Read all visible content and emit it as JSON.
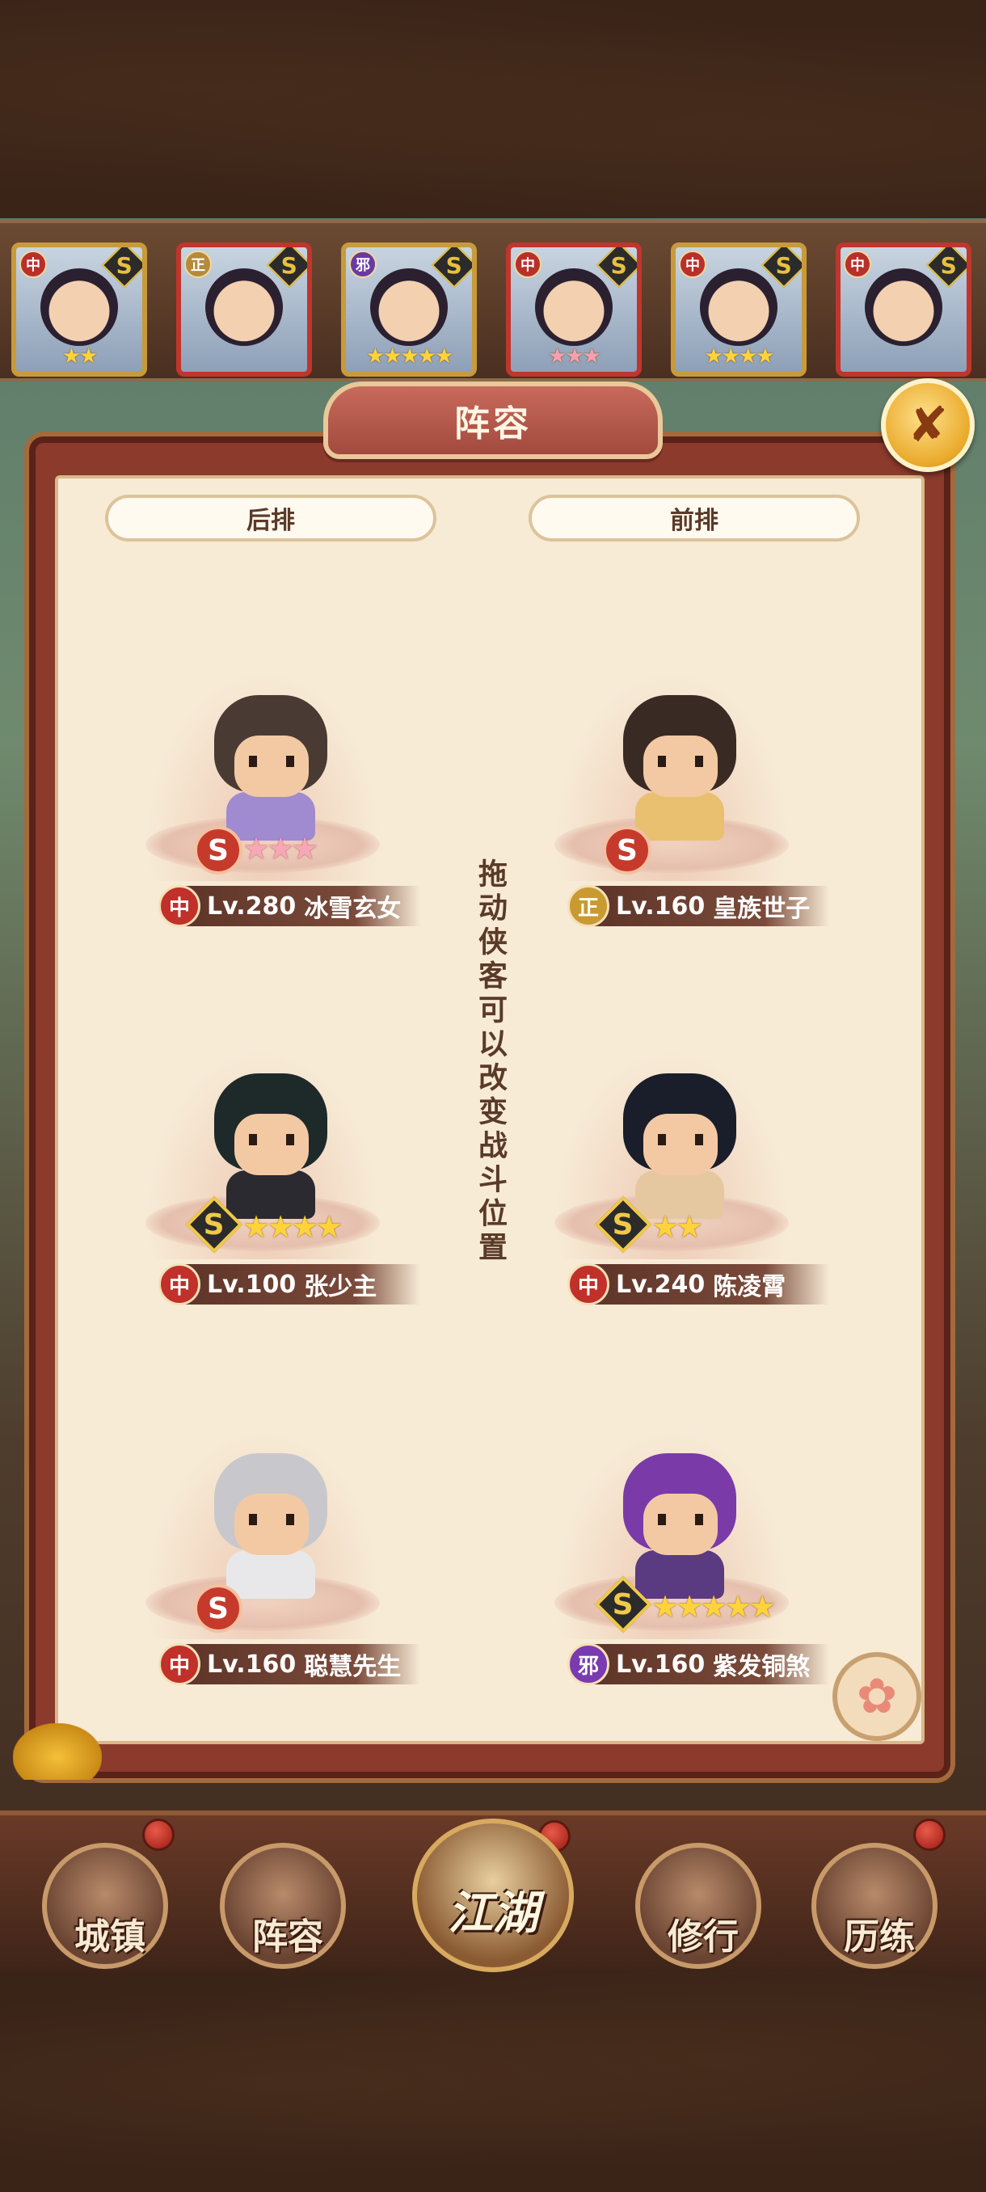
{
  "hero_strip": [
    {
      "faction": "中",
      "grade": "S",
      "stars": "★★",
      "star_color": "gold",
      "frame": "gold"
    },
    {
      "faction": "正",
      "grade": "S",
      "stars": "",
      "star_color": "gold",
      "frame": "red"
    },
    {
      "faction": "邪",
      "grade": "S",
      "stars": "★★★★★",
      "star_color": "gold",
      "frame": "gold"
    },
    {
      "faction": "中",
      "grade": "S",
      "stars": "★★★",
      "star_color": "pink",
      "frame": "red"
    },
    {
      "faction": "中",
      "grade": "S",
      "stars": "★★★★",
      "star_color": "gold",
      "frame": "gold"
    },
    {
      "faction": "中",
      "grade": "S",
      "stars": "",
      "star_color": "gold",
      "frame": "red"
    }
  ],
  "dialog": {
    "title": "阵容",
    "close_icon": "close-icon",
    "back_row_label": "后排",
    "front_row_label": "前排",
    "hint": "拖动侠客可以改变战斗位置"
  },
  "lineup": {
    "back": [
      {
        "faction": "中",
        "level": "Lv.280",
        "name": "冰雪玄女",
        "grade_style": "red",
        "stars": "★★★",
        "star_color": "pink",
        "hair": "#4a3a34",
        "robe": "#a08ad0"
      },
      {
        "faction": "中",
        "level": "Lv.100",
        "name": "张少主",
        "grade_style": "dark",
        "stars": "★★★★",
        "star_color": "gold",
        "hair": "#1e2a2a",
        "robe": "#2a2a30"
      },
      {
        "faction": "中",
        "level": "Lv.160",
        "name": "聪慧先生",
        "grade_style": "red",
        "stars": "",
        "star_color": "gold",
        "hair": "#c8c8cc",
        "robe": "#e8e8ea"
      }
    ],
    "front": [
      {
        "faction": "正",
        "level": "Lv.160",
        "name": "皇族世子",
        "grade_style": "red",
        "stars": "",
        "star_color": "gold",
        "hair": "#3a2a24",
        "robe": "#e8c070"
      },
      {
        "faction": "中",
        "level": "Lv.240",
        "name": "陈凌霄",
        "grade_style": "dark",
        "stars": "★★",
        "star_color": "gold",
        "hair": "#1a1e2a",
        "robe": "#e6c8a0"
      },
      {
        "faction": "邪",
        "level": "Lv.160",
        "name": "紫发铜煞",
        "grade_style": "dark",
        "stars": "★★★★★",
        "star_color": "gold",
        "hair": "#7a3aa8",
        "robe": "#5a3a80"
      }
    ]
  },
  "bottom_nav": [
    {
      "label": "城镇"
    },
    {
      "label": "阵容"
    },
    {
      "label": "江湖"
    },
    {
      "label": "修行"
    },
    {
      "label": "历练"
    }
  ]
}
